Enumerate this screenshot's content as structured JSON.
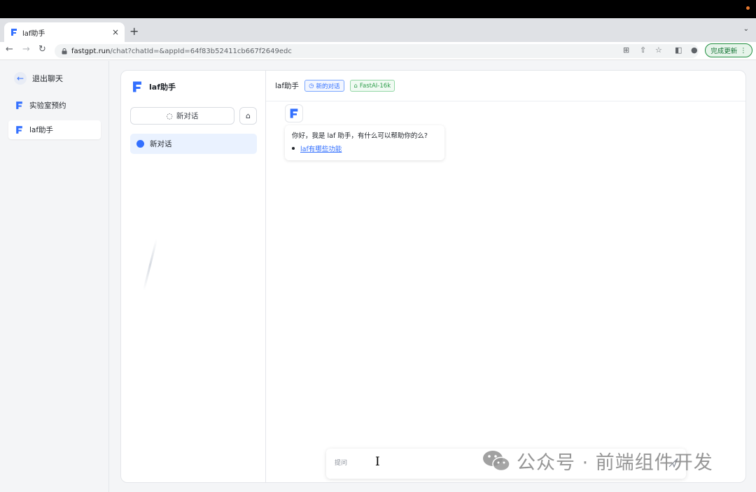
{
  "browser": {
    "tab_title": "laf助手",
    "tab_close": "×",
    "new_tab": "+",
    "tab_menu": "⌄",
    "url_host": "fastgpt.run",
    "url_path": "/chat?chatId=&appId=64f83b52411cb667f2649edc",
    "update_button": "完成更新",
    "update_menu": "⋮"
  },
  "sidebar": {
    "back_label": "退出聊天",
    "apps": [
      {
        "label": "实验室预约"
      },
      {
        "label": "laf助手"
      }
    ]
  },
  "history": {
    "app_name": "laf助手",
    "new_chat_label": "新对话",
    "items": [
      {
        "label": "新对话"
      }
    ]
  },
  "chat": {
    "title": "laf助手",
    "tag_new": "新的对话",
    "tag_model": "FastAI-16k",
    "welcome": "你好，我是 laf 助手，有什么可以帮助你的么?",
    "suggestion": "laf有哪些功能",
    "input_placeholder": "提问"
  },
  "watermark": {
    "text": "公众号 · 前端组件开发"
  },
  "colors": {
    "accent": "#3370ff",
    "update_green": "#1e8e3e"
  }
}
